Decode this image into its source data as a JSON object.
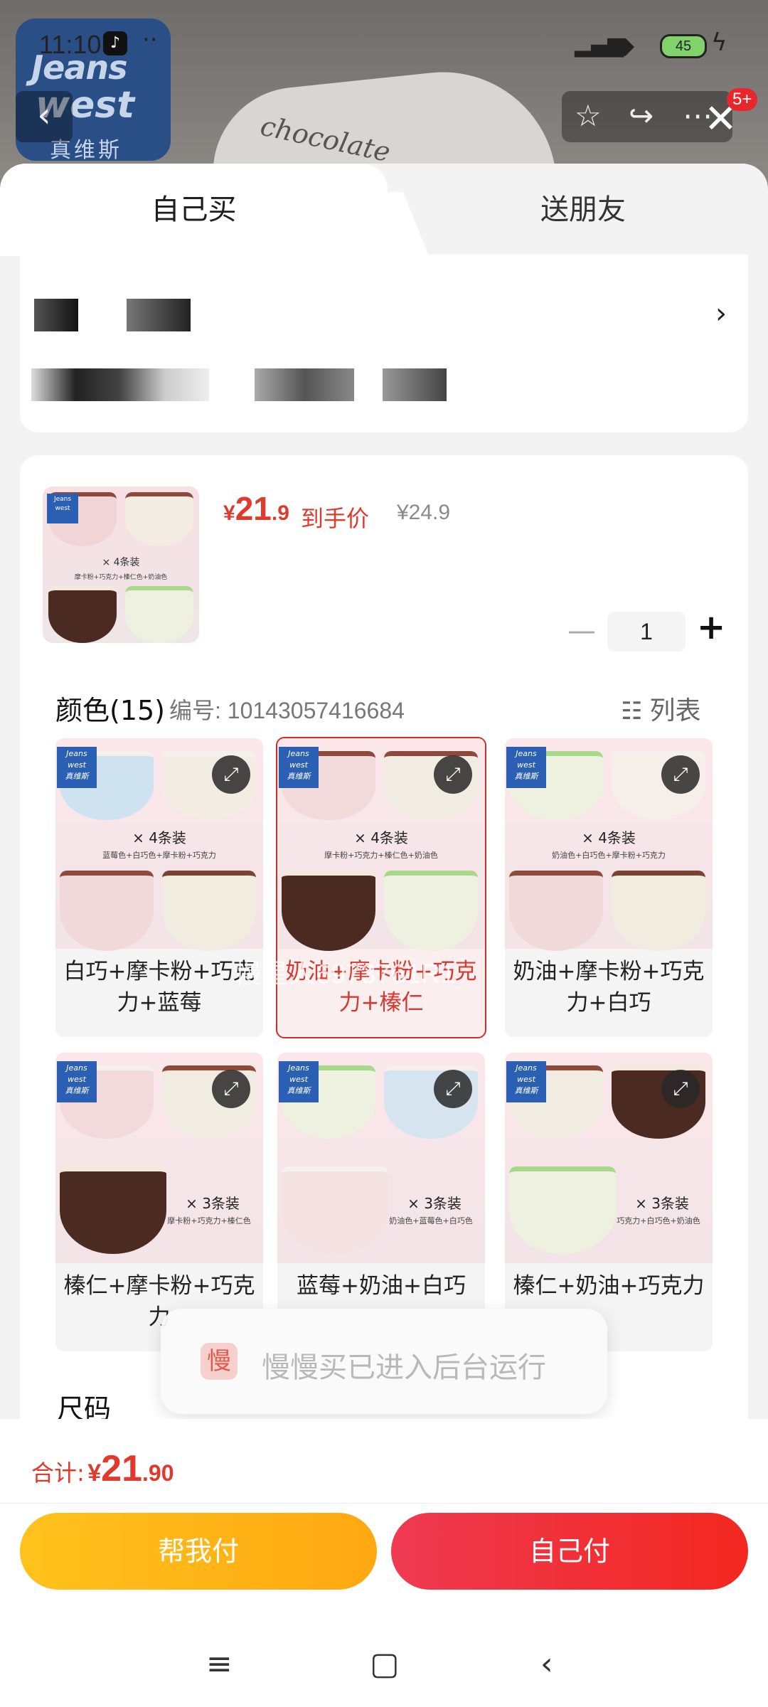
{
  "status_bar": {
    "time": "11:10",
    "dots": "··",
    "network": "HD",
    "battery": "45"
  },
  "background": {
    "brand_line1": "Jeans",
    "brand_line2": "west",
    "brand_cn": "真维斯",
    "pillow_text": "chocolate"
  },
  "top_bar": {
    "badge": "5+"
  },
  "tabs": {
    "self": "自己买",
    "friend": "送朋友"
  },
  "product": {
    "thumb_caption": "× 4条装",
    "thumb_sub": "摩卡粉+巧克力+榛仁色+奶油色",
    "price_symbol": "¥",
    "price_int": "21",
    "price_dec": ".9",
    "price_tag": "到手价",
    "price_old": "¥24.9",
    "quantity": "1"
  },
  "color_section": {
    "title": "颜色(15)",
    "code": "编号: 10143057416684",
    "list_label": "列表"
  },
  "variants": [
    {
      "pack": "× 4条装",
      "mix": "蓝莓色+白巧色+摩卡粉+巧克力",
      "name": "白巧+摩卡粉+巧克力+蓝莓"
    },
    {
      "pack": "× 4条装",
      "mix": "摩卡粉+巧克力+榛仁色+奶油色",
      "name": "奶油+摩卡粉+巧克力+榛仁"
    },
    {
      "pack": "× 4条装",
      "mix": "奶油色+白巧色+摩卡粉+巧克力",
      "name": "奶油+摩卡粉+巧克力+白巧"
    },
    {
      "pack": "× 3条装",
      "mix": "摩卡粉+巧克力+榛仁色",
      "name": "榛仁+摩卡粉+巧克力"
    },
    {
      "pack": "× 3条装",
      "mix": "奶油色+蓝莓色+白巧色",
      "name": "蓝莓+奶油+白巧"
    },
    {
      "pack": "× 3条装",
      "mix": "巧克力+白巧色+奶油色",
      "name": "榛仁+奶油+巧克力"
    }
  ],
  "watermark": "慢星人6973761R1",
  "toast": {
    "icon_char": "慢",
    "text": "慢慢买已进入后台运行"
  },
  "size_section": {
    "title": "尺码"
  },
  "footer": {
    "total_label": "合计:",
    "total_symbol": "¥",
    "total_int": "21",
    "total_dec": ".90",
    "pay_friend": "帮我付",
    "pay_self": "自己付"
  }
}
